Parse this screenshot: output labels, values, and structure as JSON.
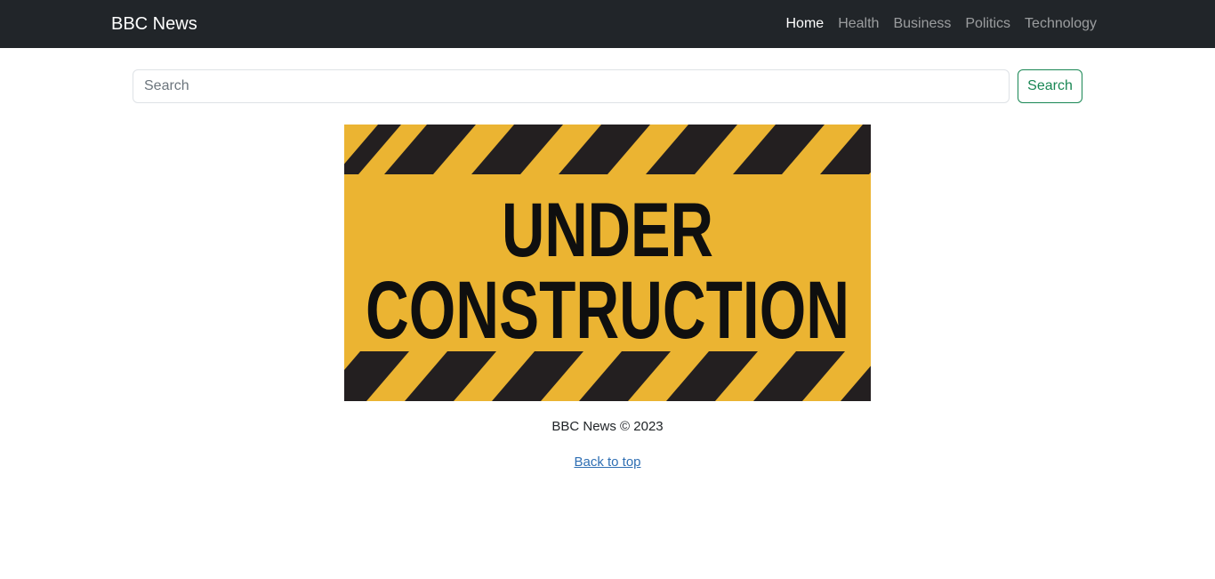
{
  "navbar": {
    "brand": "BBC News",
    "links": [
      {
        "label": "Home",
        "active": true
      },
      {
        "label": "Health",
        "active": false
      },
      {
        "label": "Business",
        "active": false
      },
      {
        "label": "Politics",
        "active": false
      },
      {
        "label": "Technology",
        "active": false
      }
    ]
  },
  "search": {
    "placeholder": "Search",
    "value": "",
    "button_label": "Search"
  },
  "banner": {
    "line1": "UNDER",
    "line2": "CONSTRUCTION"
  },
  "footer": {
    "copyright": "BBC News © 2023",
    "back_to_top": "Back to top"
  },
  "colors": {
    "navbar_bg": "#212529",
    "accent": "#198754",
    "banner_yellow": "#ebb432",
    "banner_stripe": "#231f20"
  }
}
